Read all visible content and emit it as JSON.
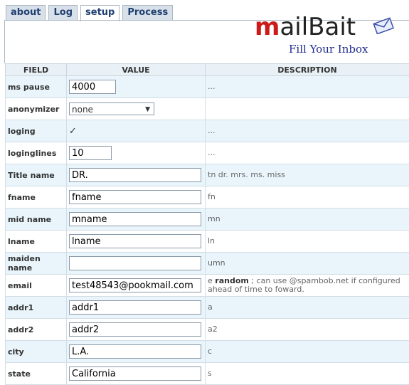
{
  "tabs": [
    {
      "label": "about"
    },
    {
      "label": "Log"
    },
    {
      "label": "setup"
    },
    {
      "label": "Process"
    }
  ],
  "logo": {
    "brand_m": "m",
    "brand_rest": "ailBait",
    "tagline": "Fill Your Inbox"
  },
  "table": {
    "headers": {
      "field": "FIELD",
      "value": "VALUE",
      "description": "DESCRIPTION"
    },
    "rows": [
      {
        "field": "ms pause",
        "value": "4000",
        "desc": "..."
      },
      {
        "field": "anonymizer",
        "value": "none",
        "desc": ""
      },
      {
        "field": "loging",
        "checked": "✓",
        "desc": "..."
      },
      {
        "field": "logingIines",
        "value": "10",
        "desc": "..."
      },
      {
        "field": "Title name",
        "value": "DR.",
        "desc": "tn dr. mrs. ms. miss"
      },
      {
        "field": "fname",
        "value": "fname",
        "desc": "fn"
      },
      {
        "field": "mid name",
        "value": "mname",
        "desc": "mn"
      },
      {
        "field": "lname",
        "value": "lname",
        "desc": "ln"
      },
      {
        "field": "maiden name",
        "value": "",
        "desc": "umn"
      },
      {
        "field": "email",
        "value": "test48543@pookmail.com",
        "desc_prefix": "e ",
        "desc_bold": "random",
        "desc_rest": " ; can use @spambob.net if configured ahead of time to foward."
      },
      {
        "field": "addr1",
        "value": "addr1",
        "desc": "a"
      },
      {
        "field": "addr2",
        "value": "addr2",
        "desc": "a2"
      },
      {
        "field": "city",
        "value": "L.A.",
        "desc": "c"
      },
      {
        "field": "state",
        "value": "California",
        "desc": "s"
      }
    ]
  }
}
